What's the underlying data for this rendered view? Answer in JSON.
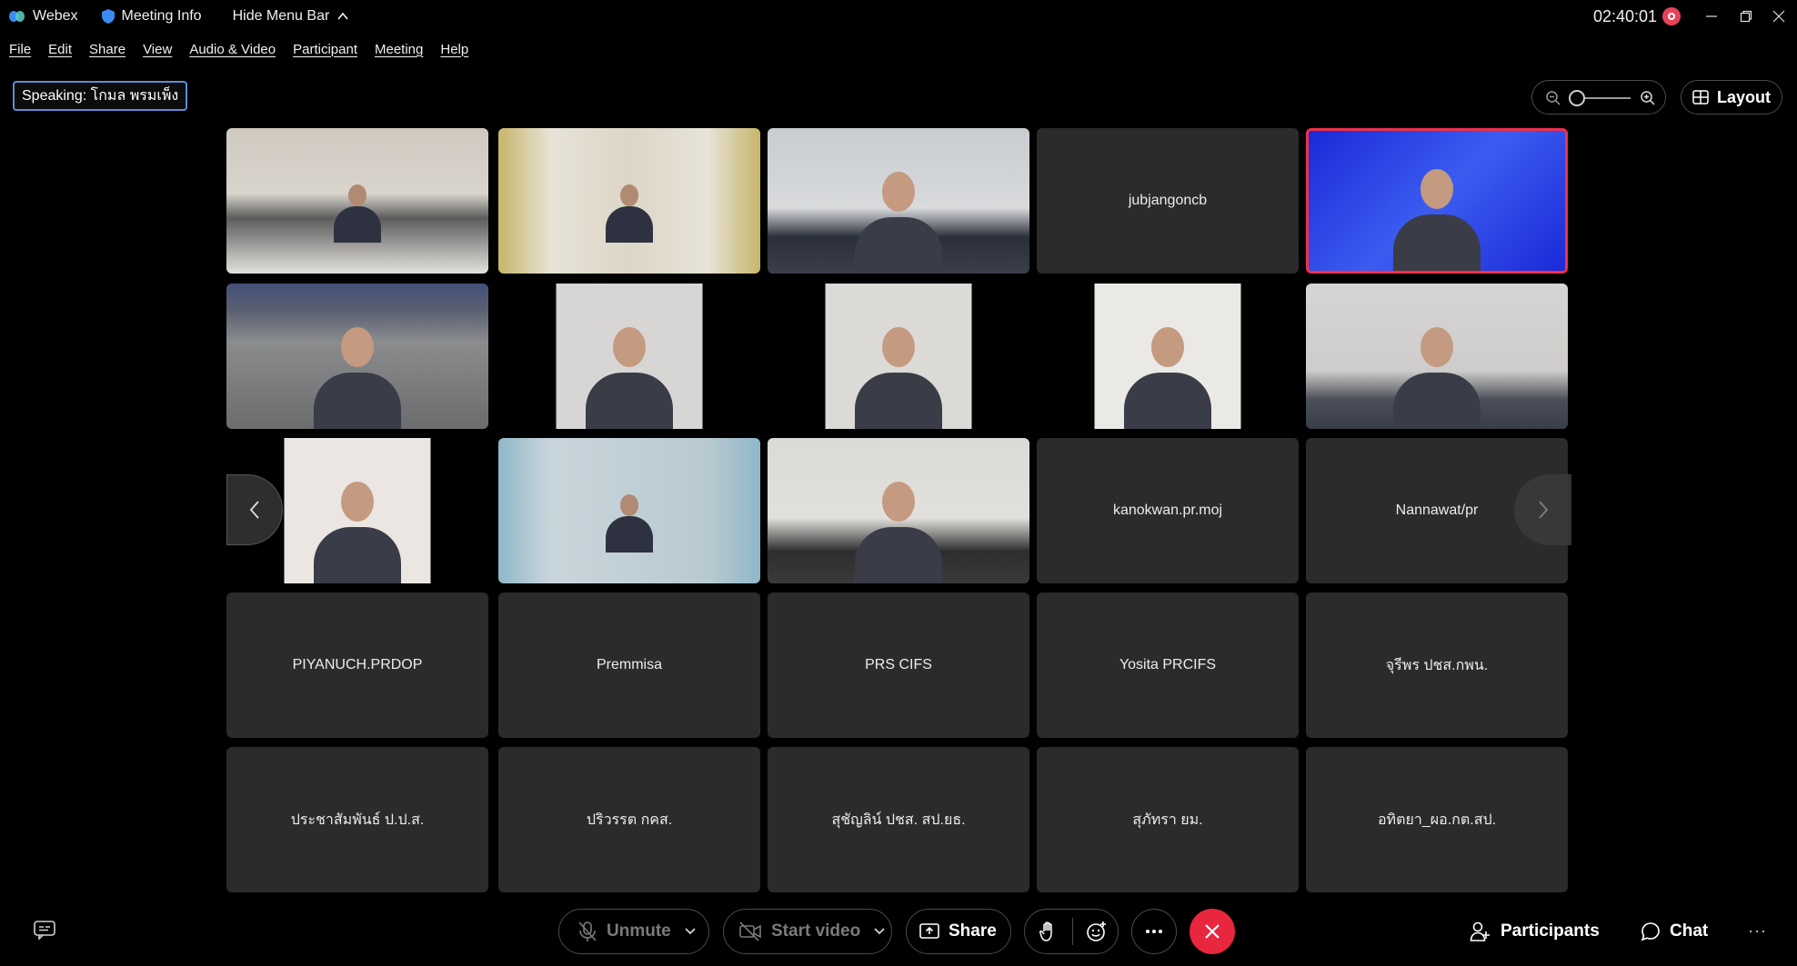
{
  "titlebar": {
    "app_name": "Webex",
    "meeting_info": "Meeting Info",
    "hide_menu": "Hide Menu Bar",
    "timer": "02:40:01"
  },
  "menu": [
    "File",
    "Edit",
    "Share",
    "View",
    "Audio & Video",
    "Participant",
    "Meeting",
    "Help"
  ],
  "speaking": "Speaking: โกมล พรมเพ็ง",
  "layout_label": "Layout",
  "participants": [
    {
      "name": "",
      "video": true
    },
    {
      "name": "",
      "video": true
    },
    {
      "name": "",
      "video": true
    },
    {
      "name": "jubjangoncb",
      "video": false
    },
    {
      "name": "",
      "video": true,
      "active_speaker": true
    },
    {
      "name": "",
      "video": true
    },
    {
      "name": "",
      "video": true
    },
    {
      "name": "",
      "video": true
    },
    {
      "name": "",
      "video": true
    },
    {
      "name": "",
      "video": true
    },
    {
      "name": "",
      "video": true
    },
    {
      "name": "",
      "video": true
    },
    {
      "name": "",
      "video": true
    },
    {
      "name": "kanokwan.pr.moj",
      "video": false
    },
    {
      "name": "Nannawat/pr",
      "video": false
    },
    {
      "name": "PIYANUCH.PRDOP",
      "video": false
    },
    {
      "name": "Premmisa",
      "video": false
    },
    {
      "name": "PRS CIFS",
      "video": false
    },
    {
      "name": "Yosita PRCIFS",
      "video": false
    },
    {
      "name": "จุรีพร ปชส.กพน.",
      "video": false
    },
    {
      "name": "ประชาสัมพันธ์ ป.ป.ส.",
      "video": false
    },
    {
      "name": "ปริวรรต กคส.",
      "video": false
    },
    {
      "name": "สุชัญลิน์ ปชส. สป.ยธ.",
      "video": false
    },
    {
      "name": "สุภัทรา ยม.",
      "video": false
    },
    {
      "name": "อทิตยา_ผอ.กต.สป.",
      "video": false
    }
  ],
  "controls": {
    "unmute": "Unmute",
    "start_video": "Start video",
    "share": "Share",
    "participants": "Participants",
    "chat": "Chat"
  },
  "colors": {
    "end_call": "#e8263e",
    "active_speaker_border": "#f0304a",
    "recording": "#e8425a",
    "speaking_border": "#5a8ed8",
    "tile_bg": "#2b2b2b"
  }
}
